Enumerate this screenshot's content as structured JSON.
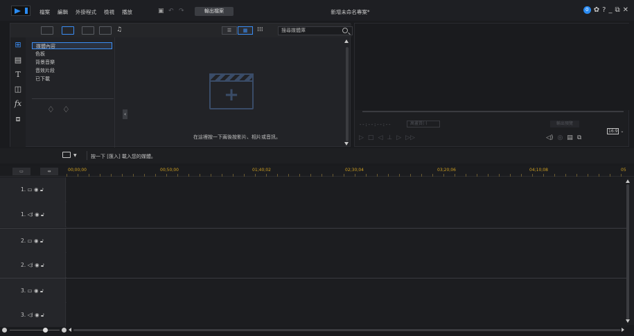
{
  "app": {
    "menu": [
      "檔案",
      "編輯",
      "外掛程式",
      "檢視",
      "播放"
    ],
    "export_label": "輸出檔案",
    "project_title": "新增未命名專案*",
    "notification_count": "0",
    "accent_color": "#3b8ef5"
  },
  "library": {
    "search_placeholder": "搜尋媒體庫",
    "categories": [
      "媒體內容",
      "色板",
      "背景音樂",
      "音效片段",
      "已下載"
    ],
    "selected_category": "媒體內容",
    "drop_hint": "在這裡按一下兩後按影片、相片或音訊。"
  },
  "preview": {
    "timecode": "--:--:--:--",
    "quality": "高畫質(·)",
    "mode": "輸出預覽",
    "aspect": "16:9"
  },
  "timeline": {
    "hint": "按一下 [匯入] 載入您的媒體。",
    "ruler_labels": [
      "00;00;00",
      "00;50;00",
      "01;40;02",
      "02;30;04",
      "03;20;06",
      "04;10;08",
      "05"
    ],
    "tracks": [
      {
        "label": "1.",
        "type": "video"
      },
      {
        "label": "1.",
        "type": "audio"
      },
      {
        "label": "2.",
        "type": "video"
      },
      {
        "label": "2.",
        "type": "audio"
      },
      {
        "label": "3.",
        "type": "video"
      },
      {
        "label": "3.",
        "type": "audio"
      }
    ]
  }
}
